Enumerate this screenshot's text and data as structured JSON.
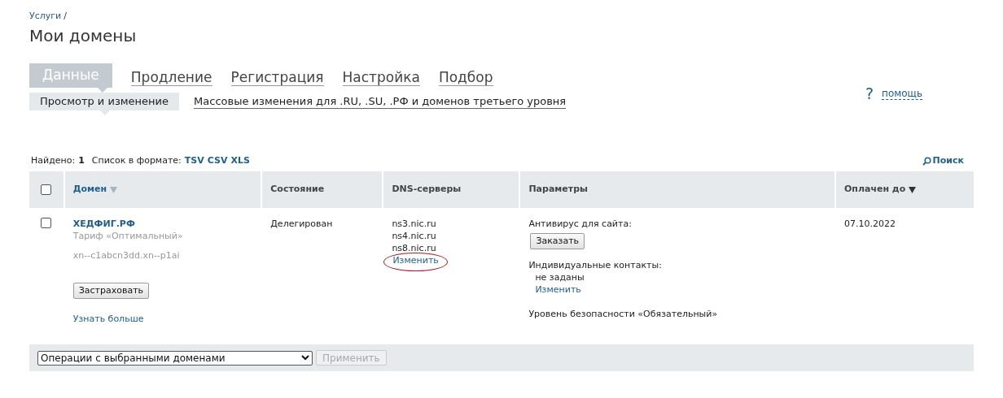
{
  "breadcrumb": {
    "link": "Услуги",
    "separator": "/"
  },
  "page_title": "Мои домены",
  "tabs": [
    {
      "label": "Данные",
      "selected": true
    },
    {
      "label": "Продление",
      "selected": false
    },
    {
      "label": "Регистрация",
      "selected": false
    },
    {
      "label": "Настройка",
      "selected": false
    },
    {
      "label": "Подбор",
      "selected": false
    }
  ],
  "subtabs": [
    {
      "label": "Просмотр и изменение",
      "selected": true
    },
    {
      "label": "Массовые изменения для .RU, .SU, .РФ и доменов третьего уровня",
      "selected": false
    }
  ],
  "help": {
    "icon": "?",
    "label": "помощь"
  },
  "summary": {
    "found_label": "Найдено:",
    "found_count": "1",
    "format_label": "Список в формате:",
    "formats": [
      "TSV",
      "CSV",
      "XLS"
    ]
  },
  "search_link": "Поиск",
  "table": {
    "select_all_checked": false,
    "columns": [
      {
        "label": "Домен",
        "link": true,
        "sort_active": false
      },
      {
        "label": "Состояние",
        "link": false
      },
      {
        "label": "DNS-серверы",
        "link": false
      },
      {
        "label": "Параметры",
        "link": false
      },
      {
        "label": "Оплачен до",
        "link": false,
        "sort_active": true
      }
    ],
    "rows": [
      {
        "checked": false,
        "domain": "ХЕДФИГ.РФ",
        "tariff": "Тариф «Оптимальный»",
        "punycode": "xn--c1abcn3dd.xn--p1ai",
        "insure_button": "Застраховать",
        "more_link": "Узнать больше",
        "status": "Делегирован",
        "dns_servers": [
          "ns3.nic.ru",
          "ns4.nic.ru",
          "ns8.nic.ru"
        ],
        "dns_change_link": "Изменить",
        "dns_change_circled": true,
        "antivirus_label": "Антивирус для сайта:",
        "antivirus_button": "Заказать",
        "contacts_label": "Индивидуальные контакты:",
        "contacts_value": "не заданы",
        "contacts_change_link": "Изменить",
        "security_level": "Уровень безопасности «Обязательный»",
        "paid_until": "07.10.2022"
      }
    ]
  },
  "bulk_action": {
    "select": "Операции с выбранными доменами",
    "apply_button": "Применить",
    "apply_disabled": true
  }
}
